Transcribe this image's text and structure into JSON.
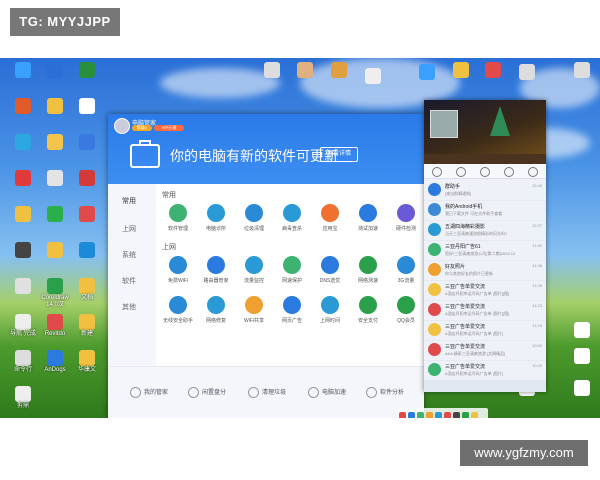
{
  "watermark_top": "TG: MYYJJPP",
  "watermark_bottom": "www.ygfzmy.com",
  "desktop_icons": [
    {
      "label": "",
      "color": "#3aa0ff"
    },
    {
      "label": "",
      "color": "#2b6fd6"
    },
    {
      "label": "",
      "color": "#2a8f3c"
    },
    {
      "label": "",
      "color": "#e05a2a"
    },
    {
      "label": "",
      "color": "#f0c040"
    },
    {
      "label": "",
      "color": "#ffffff"
    },
    {
      "label": "",
      "color": "#2da7e0"
    },
    {
      "label": "",
      "color": "#f5c44a"
    },
    {
      "label": "",
      "color": "#3a7ae0"
    },
    {
      "label": "",
      "color": "#e03a3a"
    },
    {
      "label": "",
      "color": "#e4e4e4"
    },
    {
      "label": "",
      "color": "#d33a3a"
    },
    {
      "label": "",
      "color": "#f0c040"
    },
    {
      "label": "",
      "color": "#2ab04a"
    },
    {
      "label": "",
      "color": "#e04a4a"
    },
    {
      "label": "",
      "color": "#444444"
    },
    {
      "label": "",
      "color": "#f2c040"
    },
    {
      "label": "",
      "color": "#1c8ad6"
    },
    {
      "label": "",
      "color": "#e0e0e0"
    },
    {
      "label": "Coreldraw 14.0汉",
      "color": "#2aa04a"
    },
    {
      "label": "文档",
      "color": "#f2c040"
    },
    {
      "label": "导航 完成",
      "color": "#eeeeee"
    },
    {
      "label": "Revitdo",
      "color": "#e04a4a"
    },
    {
      "label": "新建",
      "color": "#f2c040"
    },
    {
      "label": "命令行",
      "color": "#dddddd"
    },
    {
      "label": "AnDogs",
      "color": "#2a7ae0"
    },
    {
      "label": "华康文",
      "color": "#f2c040"
    },
    {
      "label": "剪鼎",
      "color": "#eeeeee"
    }
  ],
  "main_window": {
    "app_title": "电脑管家",
    "level_badge": "等级1",
    "vip_badge": "VIP开通",
    "headline": "你的电脑有新的软件可更新",
    "detail_button": "查看详情",
    "sidebar": [
      {
        "label": "常用"
      },
      {
        "label": "上网"
      },
      {
        "label": "系统"
      },
      {
        "label": "软件"
      },
      {
        "label": "其他"
      }
    ],
    "section_common": "常用",
    "section_internet": "上网",
    "apps_row1": [
      {
        "label": "软件管理",
        "color": "#3cb371"
      },
      {
        "label": "电脑诊所",
        "color": "#2a9ad6"
      },
      {
        "label": "垃圾清理",
        "color": "#2a8ad6"
      },
      {
        "label": "病毒查杀",
        "color": "#2a9ad6"
      },
      {
        "label": "应用宝",
        "color": "#f07030"
      },
      {
        "label": "测试加速",
        "color": "#2a7ae0"
      },
      {
        "label": "硬件检测",
        "color": "#6a5ad6"
      }
    ],
    "apps_row2": [
      {
        "label": "免费WiFi",
        "color": "#2a8ad6"
      },
      {
        "label": "路由器管家",
        "color": "#2a7ae0"
      },
      {
        "label": "流量监控",
        "color": "#2a9ad6"
      },
      {
        "label": "网速保护",
        "color": "#3cb371"
      },
      {
        "label": "DNS选优",
        "color": "#2a7ae0"
      },
      {
        "label": "网络测速",
        "color": "#2aa04a"
      },
      {
        "label": "3G流量",
        "color": "#2a8ad6"
      }
    ],
    "apps_row3": [
      {
        "label": "无线安全助手",
        "color": "#2a8ad6"
      },
      {
        "label": "网络修复",
        "color": "#2a9ad6"
      },
      {
        "label": "WiFi共享",
        "color": "#f0a030"
      },
      {
        "label": "网页广告",
        "color": "#2a7ae0"
      },
      {
        "label": "上网时间",
        "color": "#2a9ad6"
      },
      {
        "label": "安全支付",
        "color": "#2aa04a"
      },
      {
        "label": "QQ会员",
        "color": "#2aa04a"
      }
    ],
    "footer": [
      {
        "label": "我的管家"
      },
      {
        "label": "闲置盘分"
      },
      {
        "label": "清理垃圾"
      },
      {
        "label": "电脑加速"
      },
      {
        "label": "软件分析"
      }
    ]
  },
  "chat_panel": {
    "contacts": [
      {
        "name": "群助手",
        "msg": "[来自群聊通知]",
        "time": "12:46",
        "color": "#2a7ae0"
      },
      {
        "name": "我的Android手机",
        "msg": "我已下载文件 可在文件助手查看",
        "time": "",
        "color": "#3a8ad6"
      },
      {
        "name": "五湖四海精彩摄影",
        "msg": "当天三亚清爽漫游很精彩的风光吗?",
        "time": "12:37",
        "color": "#2a9ad6"
      },
      {
        "name": "三亚丹阳广告61",
        "msg": "您好!三亚清爽旅游公司(第二期)2024.12",
        "time": "11:40",
        "color": "#3cb371"
      },
      {
        "name": "好友照片",
        "msg": "你与其他好友的照片已更新",
        "time": "11:36",
        "color": "#f0a030"
      },
      {
        "name": "三亚广告单爱交流",
        "msg": "A酒店丹阳幸运号码广告单 [图片][图]",
        "time": "11:28",
        "color": "#f0c040"
      },
      {
        "name": "三亚广告单爱交流",
        "msg": "A酒店丹阳幸运号码广告单 [图片][图]",
        "time": "11:23",
        "color": "#e04a4a"
      },
      {
        "name": "三亚广告单爱交流",
        "msg": "A酒店丹阳幸运号码广告单 [图片]",
        "time": "11:15",
        "color": "#f0c040"
      },
      {
        "name": "三亚广告单爱交流",
        "msg": "AAA 精彩三亚清爽旅游 [文摘精品]",
        "time": "10:52",
        "color": "#e04a4a"
      },
      {
        "name": "三亚广告单爱交流",
        "msg": "A酒店丹阳幸运号码广告单 [图片]",
        "time": "10:30",
        "color": "#3cb371"
      }
    ]
  },
  "taskbar_colors": [
    "#e04a4a",
    "#2a7ae0",
    "#3cb371",
    "#f0a030",
    "#2a9ad6",
    "#e04a4a",
    "#444444",
    "#2aa04a",
    "#f0c040"
  ]
}
